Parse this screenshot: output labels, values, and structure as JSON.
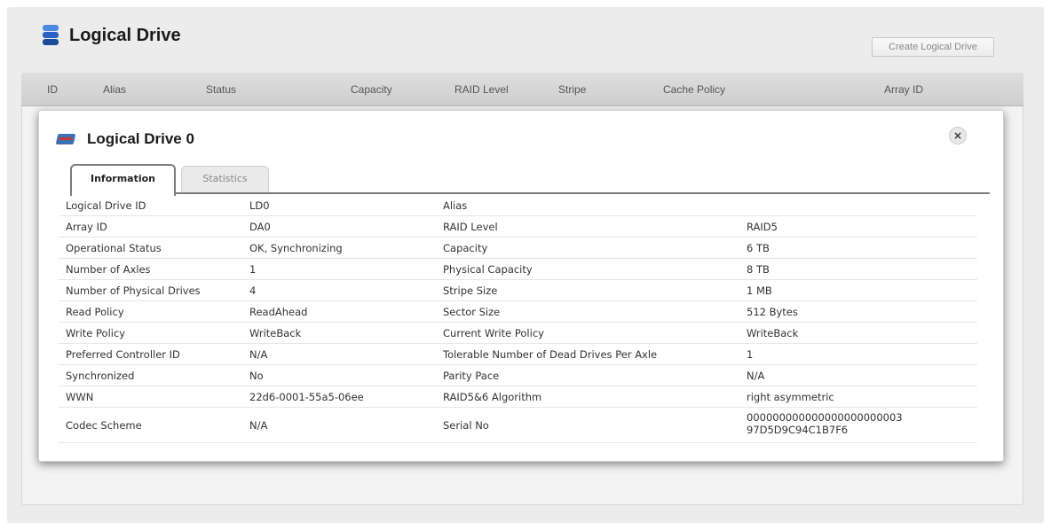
{
  "page": {
    "title": "Logical Drive",
    "create_button": "Create Logical Drive"
  },
  "table_header": {
    "columns": [
      "ID",
      "Alias",
      "Status",
      "Capacity",
      "RAID Level",
      "Stripe",
      "Cache Policy",
      "Array ID"
    ]
  },
  "modal": {
    "title": "Logical Drive 0",
    "close_symbol": "×",
    "tabs": [
      "Information",
      "Statistics"
    ],
    "active_tab": "Information",
    "rows": [
      [
        "Logical Drive ID",
        "LD0",
        "Alias",
        ""
      ],
      [
        "Array ID",
        "DA0",
        "RAID Level",
        "RAID5"
      ],
      [
        "Operational Status",
        "OK, Synchronizing",
        "Capacity",
        "6 TB"
      ],
      [
        "Number of Axles",
        "1",
        "Physical Capacity",
        "8 TB"
      ],
      [
        "Number of Physical Drives",
        "4",
        "Stripe Size",
        "1 MB"
      ],
      [
        "Read Policy",
        "ReadAhead",
        "Sector Size",
        "512 Bytes"
      ],
      [
        "Write Policy",
        "WriteBack",
        "Current Write Policy",
        "WriteBack"
      ],
      [
        "Preferred Controller ID",
        "N/A",
        "Tolerable Number of Dead Drives Per Axle",
        "1"
      ],
      [
        "Synchronized",
        "No",
        "Parity Pace",
        "N/A"
      ],
      [
        "WWN",
        "22d6-0001-55a5-06ee",
        "RAID5&6 Algorithm",
        "right asymmetric"
      ],
      [
        "Codec Scheme",
        "N/A",
        "Serial No",
        "000000000000000000000003\n97D5D9C94C1B7F6"
      ]
    ]
  },
  "icons": {
    "app": "logical-drive-icon",
    "modal": "hard-drive-icon",
    "close": "close-icon"
  }
}
